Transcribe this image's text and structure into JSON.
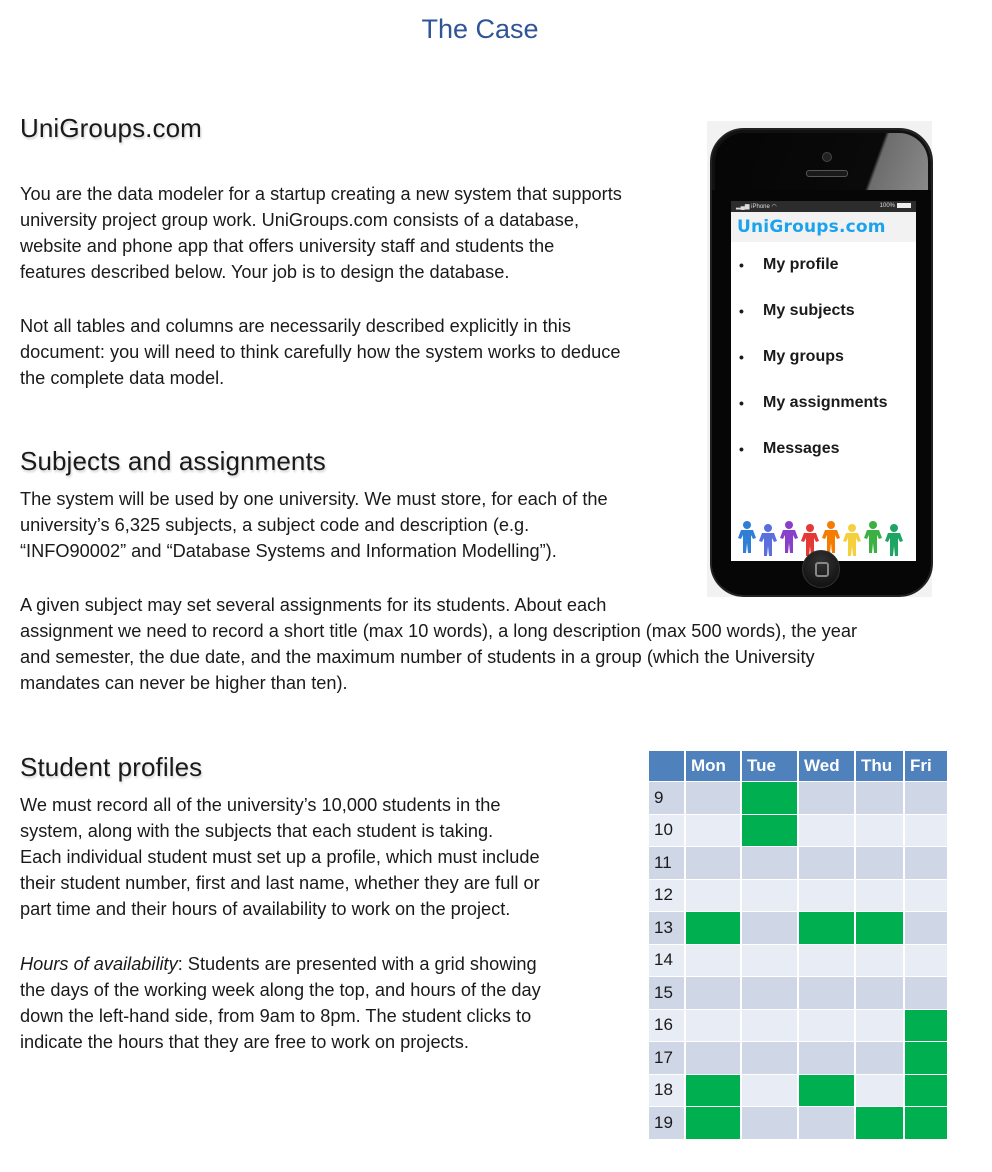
{
  "page_title": "The Case",
  "sections": {
    "intro": {
      "heading": "UniGroups.com",
      "para1": [
        "You are the data modeler for a startup creating a new system that supports",
        "university project group work. UniGroups.com consists of a database,",
        "website and phone app that offers university staff and students the",
        "features described below. Your job is to design the database."
      ],
      "para2": [
        "Not all tables and columns are necessarily described explicitly in this",
        "document: you will need to think carefully how the system works to deduce",
        "the complete data model."
      ]
    },
    "subjects": {
      "heading": "Subjects and assignments",
      "para1": [
        "The system will be used by one university. We must store, for each of the",
        "university’s 6,325 subjects, a subject code and description (e.g.",
        "“INFO90002” and “Database Systems and Information Modelling”)."
      ],
      "para2": [
        "A given subject may set several assignments for its students. About each",
        "assignment we need to record a short title (max 10 words), a long description (max 500 words), the year",
        "and semester, the due date, and the maximum number of students in a group (which the University",
        "mandates can never be higher than ten)."
      ]
    },
    "students": {
      "heading": "Student profiles",
      "para1": [
        "We must record all of the university’s 10,000 students in the",
        "system, along with the subjects that each student is taking.",
        "Each individual student must set up a profile, which must include",
        "their student number, first and last name, whether they are full or",
        "part time and their hours of availability to work on the project."
      ],
      "para2_italic": "Hours of availability",
      "para2_first_rest": ": Students are presented with a grid showing",
      "para2": [
        "the days of the working week along the top, and hours of the day",
        "down the left-hand side, from 9am to 8pm. The student clicks to",
        "indicate the hours that they are free to work on projects."
      ]
    }
  },
  "phone": {
    "status_left": "iPhone",
    "status_right": "100%",
    "brand": "UniGroups.com",
    "brand_color": "#1ca3ec",
    "menu": [
      "My profile",
      "My subjects",
      "My groups",
      "My assignments",
      "Messages"
    ],
    "people_colors": [
      "#2f7fd6",
      "#5a6fdc",
      "#8a3fc9",
      "#e53935",
      "#f57c00",
      "#f4d03f",
      "#3cb043",
      "#1fa563"
    ]
  },
  "availability": {
    "header_color": "#4f81bd",
    "free_color": "#00b050",
    "days": [
      "Mon",
      "Tue",
      "Wed",
      "Thu",
      "Fri"
    ],
    "hours": [
      "9",
      "10",
      "11",
      "12",
      "13",
      "14",
      "15",
      "16",
      "17",
      "18",
      "19"
    ],
    "free": {
      "9": [
        "Tue"
      ],
      "10": [
        "Tue"
      ],
      "11": [],
      "12": [],
      "13": [
        "Mon",
        "Wed",
        "Thu"
      ],
      "14": [],
      "15": [],
      "16": [
        "Fri"
      ],
      "17": [
        "Fri"
      ],
      "18": [
        "Mon",
        "Wed",
        "Fri"
      ],
      "19": [
        "Mon",
        "Thu",
        "Fri"
      ]
    }
  }
}
